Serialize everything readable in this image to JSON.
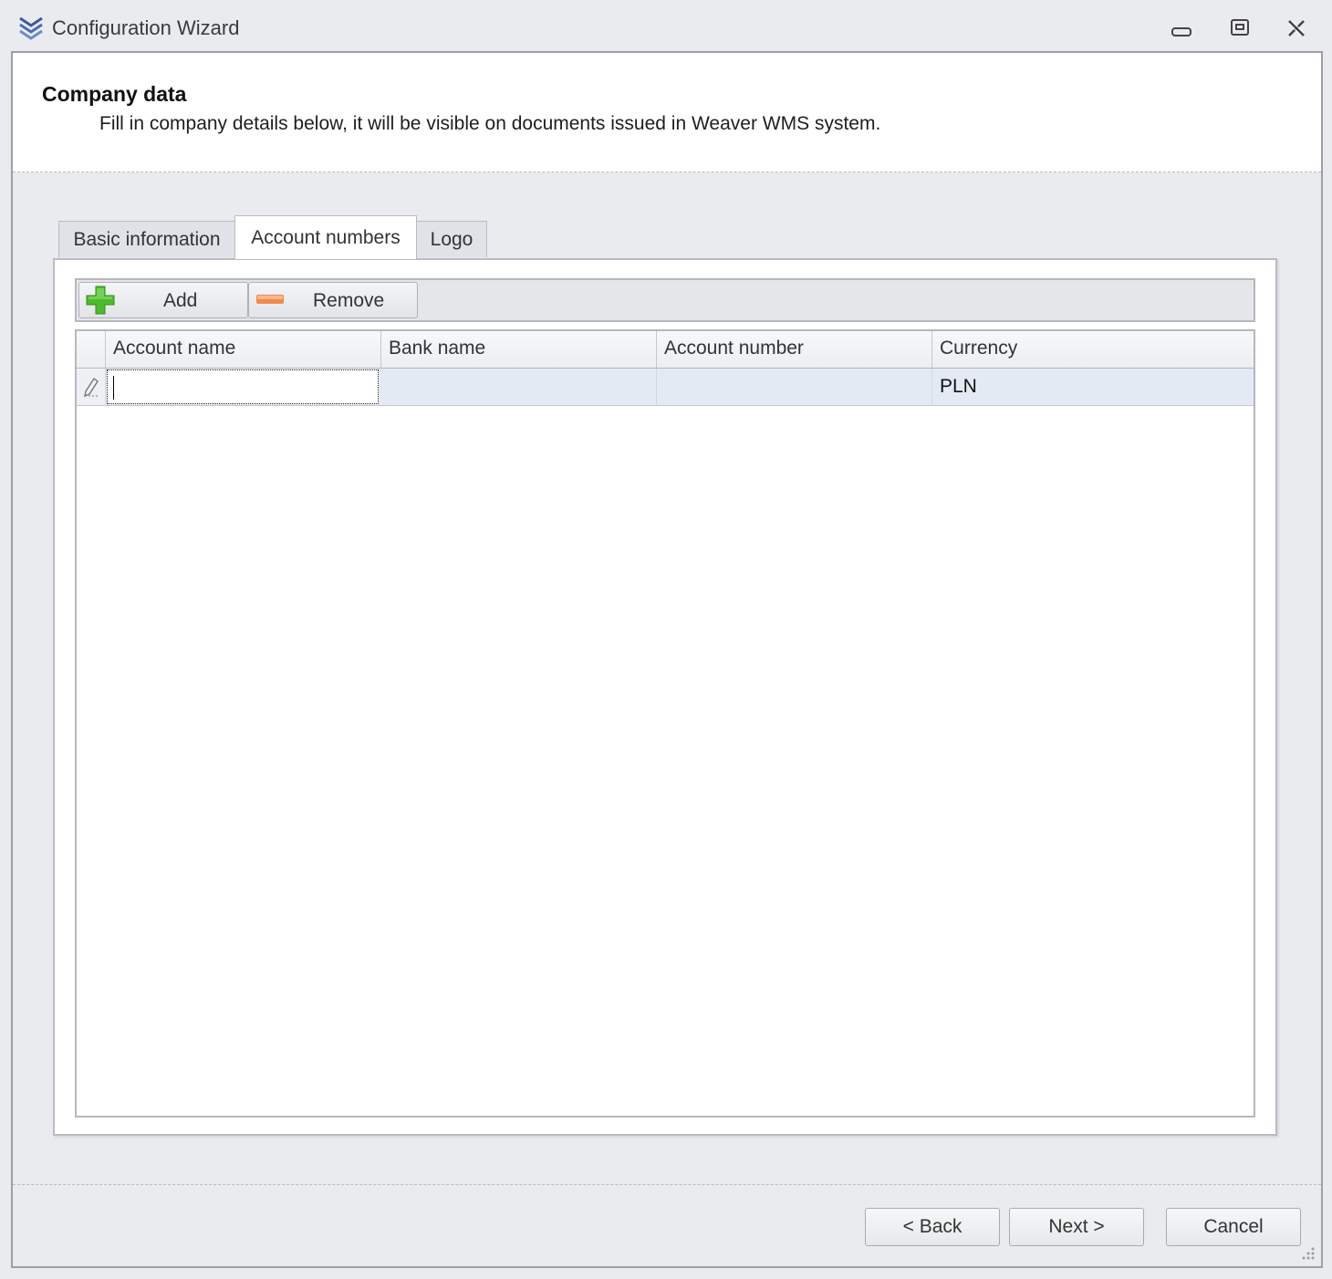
{
  "window": {
    "title": "Configuration Wizard",
    "app_icon": "chevrons-down-icon",
    "controls": [
      "minimize-icon",
      "restore-icon",
      "close-icon"
    ]
  },
  "header": {
    "title": "Company data",
    "description": "Fill in company details below, it will be visible on documents issued in Weaver WMS system."
  },
  "tabs": [
    {
      "label": "Basic information",
      "active": false
    },
    {
      "label": "Account numbers",
      "active": true
    },
    {
      "label": "Logo",
      "active": false
    }
  ],
  "toolbar": {
    "add_label": "Add",
    "add_icon": "plus-icon",
    "remove_label": "Remove",
    "remove_icon": "minus-icon"
  },
  "grid": {
    "columns": [
      "Account name",
      "Bank name",
      "Account number",
      "Currency"
    ],
    "rows": [
      {
        "account_name": "",
        "bank_name": "",
        "account_number": "",
        "currency": "PLN",
        "editing": true
      }
    ],
    "row_indicator_icon": "pencil-icon"
  },
  "footer": {
    "back_label": "< Back",
    "next_label": "Next >",
    "cancel_label": "Cancel"
  },
  "colors": {
    "background": "#e9ebee",
    "selected_row": "#e3eaf4",
    "add_icon": "#4cbb2e",
    "remove_icon": "#f08a4b"
  }
}
